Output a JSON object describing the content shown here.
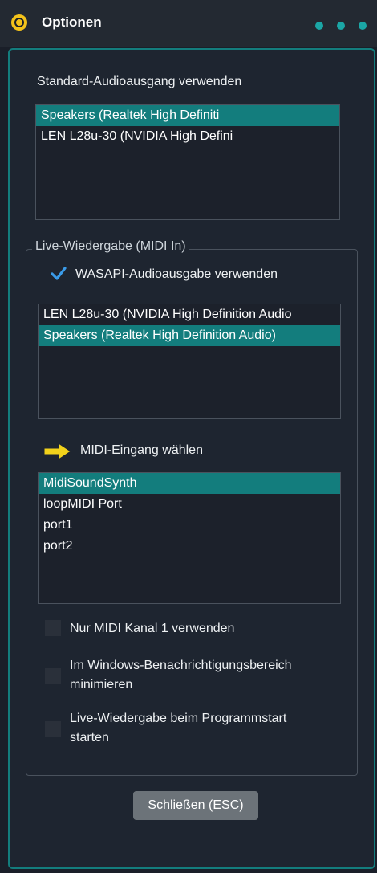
{
  "window": {
    "title": "Optionen"
  },
  "output": {
    "label": "Standard-Audioausgang verwenden",
    "devices": [
      "Speakers (Realtek High Definiti",
      "LEN L28u-30 (NVIDIA High Defini"
    ],
    "selected_index": 0
  },
  "live": {
    "group_label": "Live-Wiedergabe (MIDI In)",
    "wasapi": {
      "label": "WASAPI-Audioausgabe verwenden",
      "checked": true
    },
    "wasapi_devices": [
      "LEN L28u-30 (NVIDIA High Definition Audio",
      "Speakers (Realtek High Definition Audio)"
    ],
    "wasapi_selected_index": 1,
    "midi_label": "MIDI-Eingang wählen",
    "midi_inputs": [
      "MidiSoundSynth",
      "loopMIDI Port",
      "port1",
      "port2"
    ],
    "midi_selected_index": 0,
    "options": [
      {
        "line1": "Nur MIDI Kanal 1 verwenden",
        "line2": "",
        "checked": false
      },
      {
        "line1": "Im Windows-Benachrichtigungsbereich",
        "line2": "minimieren",
        "checked": false
      },
      {
        "line1": "Live-Wiedergabe beim Programmstart",
        "line2": "starten",
        "checked": false
      }
    ]
  },
  "close_label": "Schließen (ESC)",
  "colors": {
    "accent": "#137d7d",
    "logo": "#f3c21a",
    "arrow": "#f2d21b"
  }
}
